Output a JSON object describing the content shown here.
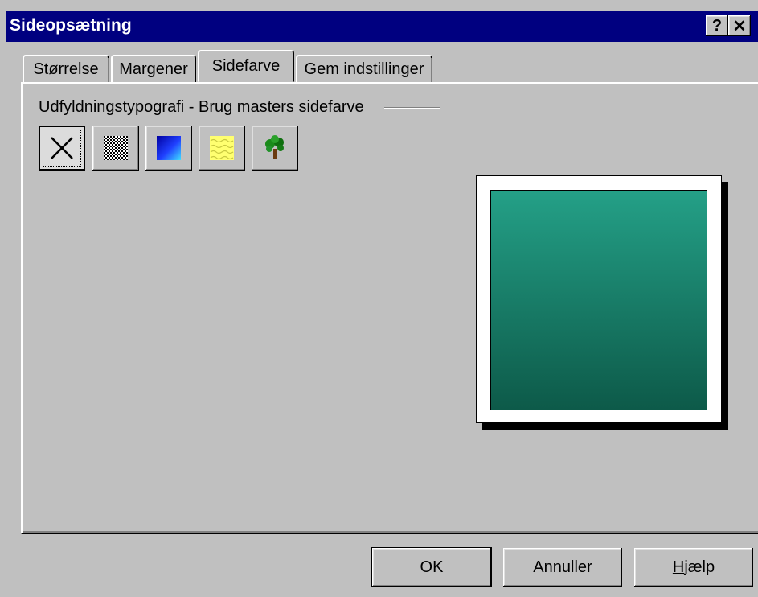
{
  "window": {
    "title": "Sideopsætning",
    "help_glyph": "?",
    "close_glyph": "✕"
  },
  "tabs": [
    {
      "label": "Størrelse",
      "active": false
    },
    {
      "label": "Margener",
      "active": false
    },
    {
      "label": "Sidefarve",
      "active": true
    },
    {
      "label": "Gem indstillinger",
      "active": false
    }
  ],
  "fill_group": {
    "label": "Udfyldningstypografi - Brug masters sidefarve",
    "options": [
      {
        "name": "no-fill",
        "icon": "x-icon",
        "selected": true
      },
      {
        "name": "pattern",
        "icon": "checker-pattern-icon",
        "selected": false
      },
      {
        "name": "gradient",
        "icon": "blue-gradient-icon",
        "selected": false
      },
      {
        "name": "texture",
        "icon": "yellow-texture-icon",
        "selected": false
      },
      {
        "name": "picture",
        "icon": "tree-picture-icon",
        "selected": false
      }
    ]
  },
  "preview": {
    "fill_top_color": "#24a087",
    "fill_bottom_color": "#0d5a49"
  },
  "buttons": {
    "ok": "OK",
    "cancel": "Annuller",
    "help_underlined": "H",
    "help_rest": "jælp"
  }
}
